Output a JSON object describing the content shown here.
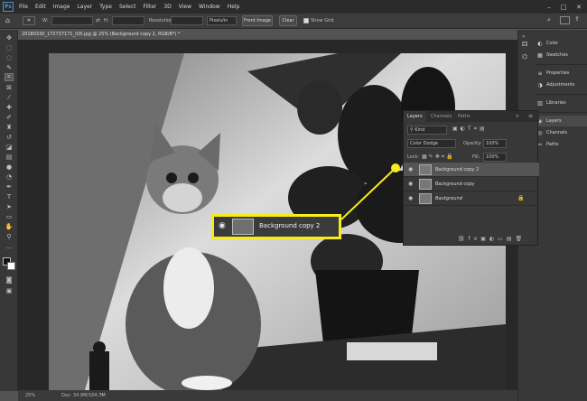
{
  "menubar": {
    "items": [
      "File",
      "Edit",
      "Image",
      "Layer",
      "Type",
      "Select",
      "Filter",
      "3D",
      "View",
      "Window",
      "Help"
    ]
  },
  "options": {
    "w_label": "W:",
    "h_label": "H:",
    "resolution_label": "Resolution:",
    "units_value": "Pixels/in",
    "front_image": "Front Image",
    "clear": "Clear",
    "show_grid": "Show Grid"
  },
  "document": {
    "tab_title": "20180330_172737171_iOS.jpg @ 25% (Background copy 2, RGB/8*) *"
  },
  "status": {
    "zoom": "25%",
    "doc_info": "Doc: 34.9M/104.7M"
  },
  "dock": {
    "items": [
      "Color",
      "Swatches",
      "Properties",
      "Adjustments",
      "Libraries",
      "Layers",
      "Channels",
      "Paths"
    ]
  },
  "layers_panel": {
    "tabs": [
      "Layers",
      "Channels",
      "Paths"
    ],
    "filter_kind": "Kind",
    "blend_mode": "Color Dodge",
    "opacity_label": "Opacity:",
    "opacity_value": "100%",
    "lock_label": "Lock:",
    "fill_label": "Fill:",
    "fill_value": "100%",
    "layers": [
      {
        "name": "Background copy 2",
        "selected": true
      },
      {
        "name": "Background copy",
        "selected": false
      },
      {
        "name": "Background",
        "selected": false
      }
    ]
  },
  "callout": {
    "label": "Background copy 2",
    "color": "#f5ec1c"
  }
}
